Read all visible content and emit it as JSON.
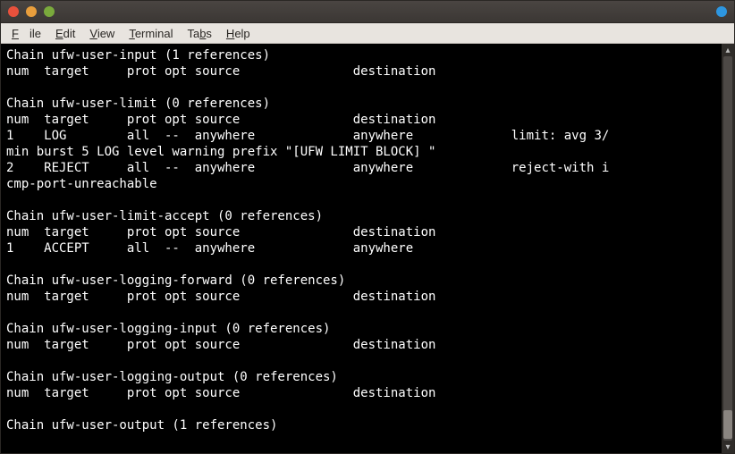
{
  "menubar": {
    "file": "File",
    "edit": "Edit",
    "view": "View",
    "terminal": "Terminal",
    "tabs": "Tabs",
    "help": "Help"
  },
  "terminal_text": "Chain ufw-user-input (1 references)\nnum  target     prot opt source               destination\n\nChain ufw-user-limit (0 references)\nnum  target     prot opt source               destination\n1    LOG        all  --  anywhere             anywhere             limit: avg 3/\nmin burst 5 LOG level warning prefix \"[UFW LIMIT BLOCK] \"\n2    REJECT     all  --  anywhere             anywhere             reject-with i\ncmp-port-unreachable\n\nChain ufw-user-limit-accept (0 references)\nnum  target     prot opt source               destination\n1    ACCEPT     all  --  anywhere             anywhere\n\nChain ufw-user-logging-forward (0 references)\nnum  target     prot opt source               destination\n\nChain ufw-user-logging-input (0 references)\nnum  target     prot opt source               destination\n\nChain ufw-user-logging-output (0 references)\nnum  target     prot opt source               destination\n\nChain ufw-user-output (1 references)"
}
